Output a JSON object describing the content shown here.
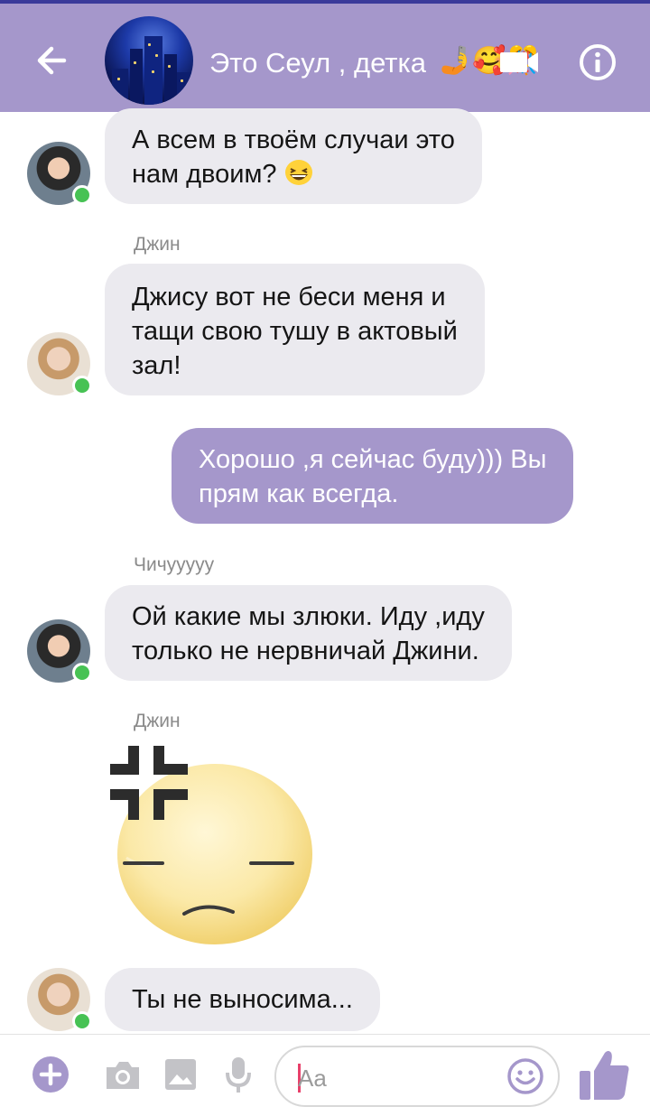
{
  "header": {
    "title": "Это Сеул , детка",
    "title_emoji": "🤳🥰🎊",
    "back_icon": "arrow-left-icon",
    "video_icon": "video-camera-icon",
    "info_icon": "info-icon"
  },
  "colors": {
    "accent": "#a597cb",
    "bubble_incoming": "#ebeaef",
    "online": "#47c254",
    "text": "#151515"
  },
  "messages": [
    {
      "type": "incoming",
      "sender": "",
      "lines": [
        "А всем в твоём случаи это",
        "нам двоим? "
      ],
      "emoji": "grinning-squinting-face",
      "avatar": "avatar-girl"
    },
    {
      "type": "incoming",
      "sender": "Джин",
      "lines": [
        "Джису вот не беси меня и",
        "тащи свою тушу в актовый",
        "зал!"
      ],
      "avatar": "avatar-guy"
    },
    {
      "type": "outgoing",
      "lines": [
        "Хорошо ,я сейчас буду))) Вы",
        "прям как всегда."
      ]
    },
    {
      "type": "incoming",
      "sender": "Чичууууу",
      "lines": [
        "Ой какие мы злюки. Иду ,иду",
        "только не нервничай Джини."
      ],
      "avatar": "avatar-girl"
    },
    {
      "type": "sticker",
      "sender": "Джин",
      "sticker": "annoyed-face-sticker"
    },
    {
      "type": "incoming",
      "sender": "",
      "lines": [
        "Ты не выносима..."
      ],
      "avatar": "avatar-guy"
    }
  ],
  "composer": {
    "placeholder": "Aa",
    "icons": [
      "plus-icon",
      "camera-icon",
      "gallery-icon",
      "microphone-icon",
      "emoji-icon",
      "thumbs-up-icon"
    ]
  }
}
